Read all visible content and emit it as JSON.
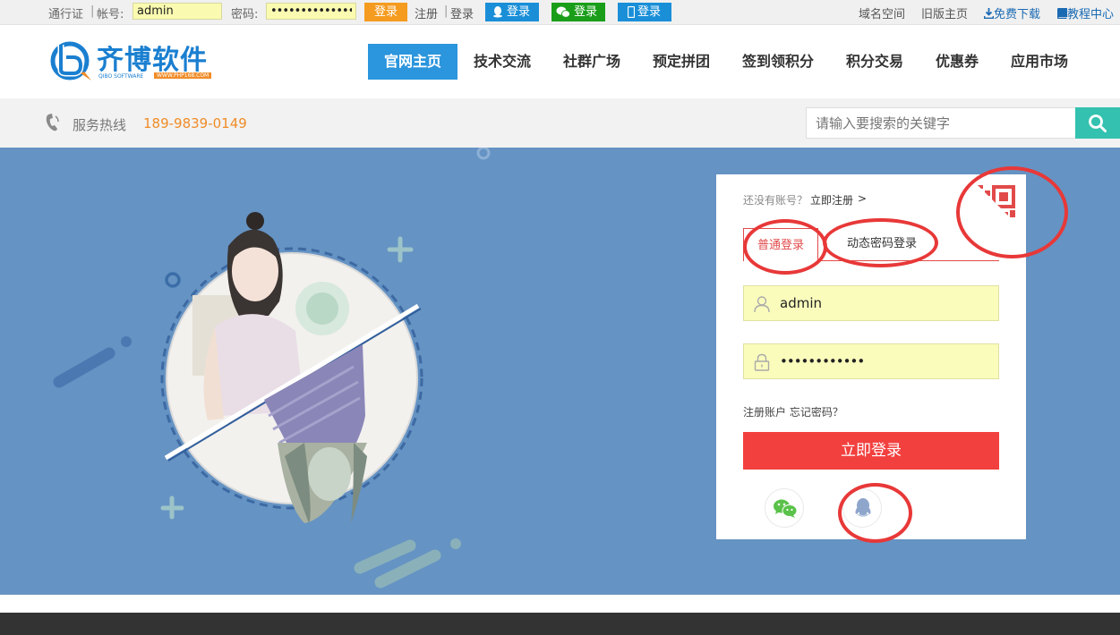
{
  "topbar": {
    "passport_label": "通行证",
    "sep1": "|",
    "account_label": "帐号:",
    "account_value": "admin",
    "password_label": "密码:",
    "password_value": "••••••••••••••",
    "login_button": "登录",
    "register_link": "注册",
    "sep2": "|",
    "login_link": "登录",
    "qq_login": "登录",
    "wechat_login": "登录",
    "phone_login": "登录",
    "right_links": [
      "域名空间",
      "旧版主页",
      "免费下载",
      "教程中心"
    ]
  },
  "header": {
    "logo_text": "齐博软件",
    "logo_sub_left": "QIBO SOFTWARE",
    "logo_sub_right": "WWW.PHP168.COM",
    "nav": [
      {
        "label": "官网主页",
        "active": true
      },
      {
        "label": "技术交流"
      },
      {
        "label": "社群广场"
      },
      {
        "label": "预定拼团"
      },
      {
        "label": "签到领积分"
      },
      {
        "label": "积分交易"
      },
      {
        "label": "优惠券"
      },
      {
        "label": "应用市场"
      }
    ]
  },
  "hotline": {
    "label": "服务热线",
    "number": "189-9839-0149"
  },
  "search": {
    "placeholder": "请输入要搜索的关键字"
  },
  "login": {
    "no_account": "还没有账号？",
    "register_now": "立即注册",
    "arrow": ">",
    "tab_normal": "普通登录",
    "tab_dynamic": "动态密码登录",
    "username": "admin",
    "password": "••••••••••••",
    "register_account": "注册账户",
    "forgot_password": "忘记密码？",
    "submit": "立即登录"
  },
  "colors": {
    "banner": "#6593c3",
    "accent_red": "#f2403f",
    "nav_active": "#2b95dd",
    "hotline": "#f08c28",
    "search_btn": "#34c1b0",
    "annotation_red": "#e83838"
  }
}
